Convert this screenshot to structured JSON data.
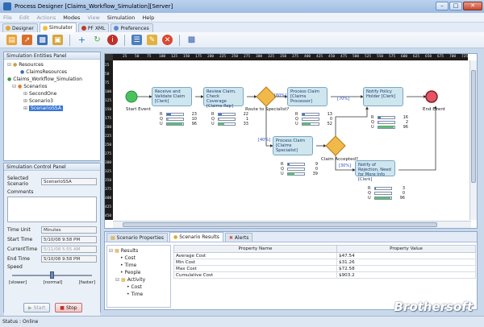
{
  "window": {
    "title": "Process Designer [Claims_Workflow_Simulation][Server]"
  },
  "menu": [
    "File",
    "Edit",
    "Actions",
    "Modes",
    "View",
    "Simulation",
    "Help"
  ],
  "menu_disabled": [
    true,
    true,
    true,
    false,
    true,
    false,
    false
  ],
  "tabs": [
    "Designer",
    "Simulator",
    "PF XML",
    "Preferences"
  ],
  "left": {
    "entities_title": "Simulation Entities Panel",
    "tree": {
      "resources": "Resources",
      "claims_resources": "ClaimsResources",
      "workflow": "Claims_Workflow_Simulation",
      "scenarios": "Scenarios",
      "second_one": "SecondOne",
      "scenario3": "Scenario3",
      "scenario_ssa": "ScenarioSSA"
    },
    "control_title": "Simulation Control Panel",
    "selected_label": "Selected Scenario",
    "selected_value": "ScenarioSSA",
    "comments_label": "Comments",
    "time_unit_label": "Time Unit",
    "time_unit_value": "Minutes",
    "start_label": "Start Time",
    "start_value": "5/10/08  9:58 PM",
    "current_label": "CurrentTime",
    "current_value": "5/11/08  5:55 AM",
    "end_label": "End Time",
    "end_value": "5/10/08  9:58 PM",
    "speed_label": "Speed",
    "speed_level": 0.5,
    "speed_ticks": [
      "[slower]",
      "[normal]",
      "[faster]"
    ],
    "start_button": "Start",
    "stop_button": "Stop"
  },
  "ruler": {
    "top": [
      "25",
      "50",
      "75",
      "100",
      "125",
      "150",
      "175",
      "200",
      "225",
      "250",
      "275",
      "300",
      "325",
      "350",
      "375",
      "400",
      "425",
      "450",
      "475",
      "500",
      "525",
      "550",
      "575",
      "600",
      "625",
      "650",
      "675",
      "700",
      "725"
    ],
    "left": [
      "25",
      "50",
      "75",
      "100",
      "125",
      "150",
      "175",
      "200",
      "225",
      "250",
      "275",
      "300",
      "325",
      "350",
      "375",
      "400",
      "425",
      "450"
    ]
  },
  "diagram": {
    "start_event": "Start Event",
    "end_event": "End Event",
    "route_label": "Route to Specialist?",
    "claim_label": "Claim Accepted?",
    "tasks": {
      "t1": "Receive and Validate Claim [Clerk]",
      "t2": "Review Claim, Check Coverage [Claims Rep]",
      "t3": "Process Claim [Claims Processor]",
      "t4": "Notify Policy Holder [Clerk]",
      "t5": "Process Claim [Claims Specialist]",
      "t6": "Notify of Rejection, Need for More Info [Clerk]"
    },
    "percents": {
      "p1": "[60%]",
      "p2": "[40%]",
      "p3": "[70%]",
      "p4": "[30%]"
    },
    "stats": {
      "s1": {
        "R": "23",
        "Q": "10",
        "U": "96"
      },
      "s2": {
        "R": "22",
        "Q": "1",
        "U": "33"
      },
      "s3": {
        "R": "13",
        "Q": "0",
        "U": "52"
      },
      "s4": {
        "R": "16",
        "Q": "2",
        "U": "96"
      },
      "s5": {
        "R": "9",
        "Q": "0",
        "U": "39"
      },
      "s6": {
        "R": "3",
        "Q": "0",
        "U": "96"
      }
    },
    "stat_keys": {
      "r": "R",
      "q": "Q",
      "u": "U"
    }
  },
  "bottom": {
    "tabs": [
      "Scenario Properties",
      "Scenario Results",
      "Alerts"
    ],
    "tree": {
      "results": "Results",
      "cost": "Cost",
      "time": "Time",
      "people": "People",
      "activity": "Activity",
      "a_cost": "Cost",
      "a_time": "Time"
    },
    "table": {
      "headers": [
        "Property Name",
        "Property Value"
      ],
      "rows": [
        [
          "Average Cost",
          "$47.54"
        ],
        [
          "Min Cost",
          "$31.26"
        ],
        [
          "Max Cost",
          "$72.58"
        ],
        [
          "Cumulative Cost",
          "$903.2"
        ]
      ]
    }
  },
  "status": "Status : Online",
  "watermark": "Brothersoft"
}
